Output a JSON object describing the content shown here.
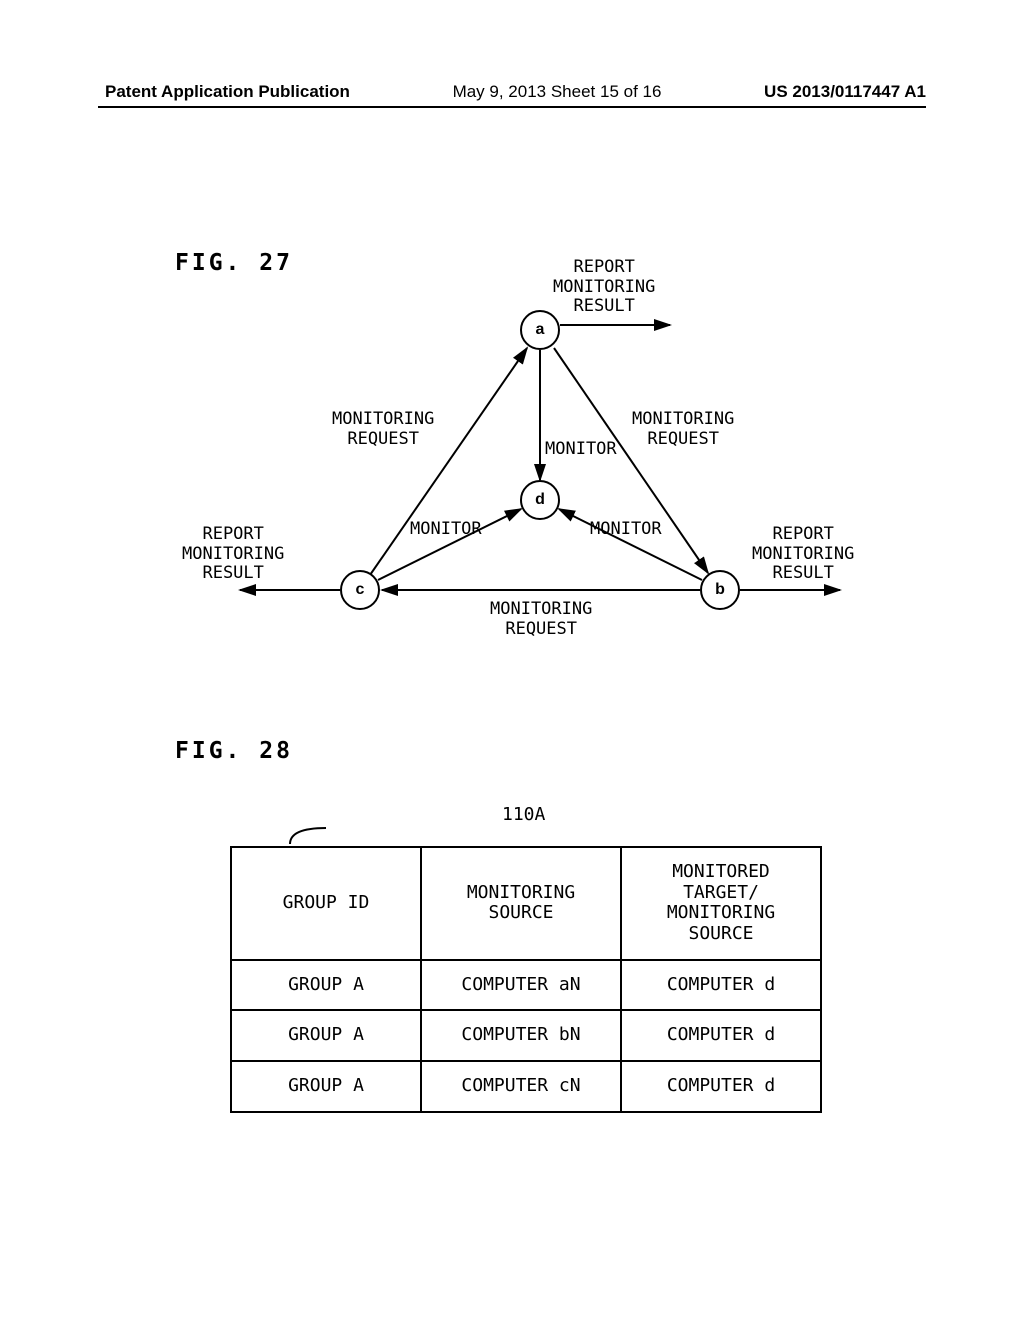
{
  "header": {
    "left": "Patent Application Publication",
    "center": "May 9, 2013  Sheet 15 of 16",
    "right": "US 2013/0117447 A1"
  },
  "fig27": {
    "label": "FIG. 27",
    "nodes": {
      "a": "a",
      "b": "b",
      "c": "c",
      "d": "d"
    },
    "labels": {
      "report_a": "REPORT\nMONITORING\nRESULT",
      "report_b": "REPORT\nMONITORING\nRESULT",
      "report_c": "REPORT\nMONITORING\nRESULT",
      "monreq_left": "MONITORING\nREQUEST",
      "monreq_right": "MONITORING\nREQUEST",
      "monreq_bottom": "MONITORING\nREQUEST",
      "monitor_ad": "MONITOR",
      "monitor_cd": "MONITOR",
      "monitor_bd": "MONITOR"
    }
  },
  "fig28": {
    "label": "FIG. 28",
    "ref": "110A",
    "headers": [
      "GROUP ID",
      "MONITORING SOURCE",
      "MONITORED TARGET/\nMONITORING SOURCE"
    ],
    "rows": [
      [
        "GROUP A",
        "COMPUTER aN",
        "COMPUTER d"
      ],
      [
        "GROUP A",
        "COMPUTER bN",
        "COMPUTER d"
      ],
      [
        "GROUP A",
        "COMPUTER cN",
        "COMPUTER d"
      ]
    ]
  }
}
